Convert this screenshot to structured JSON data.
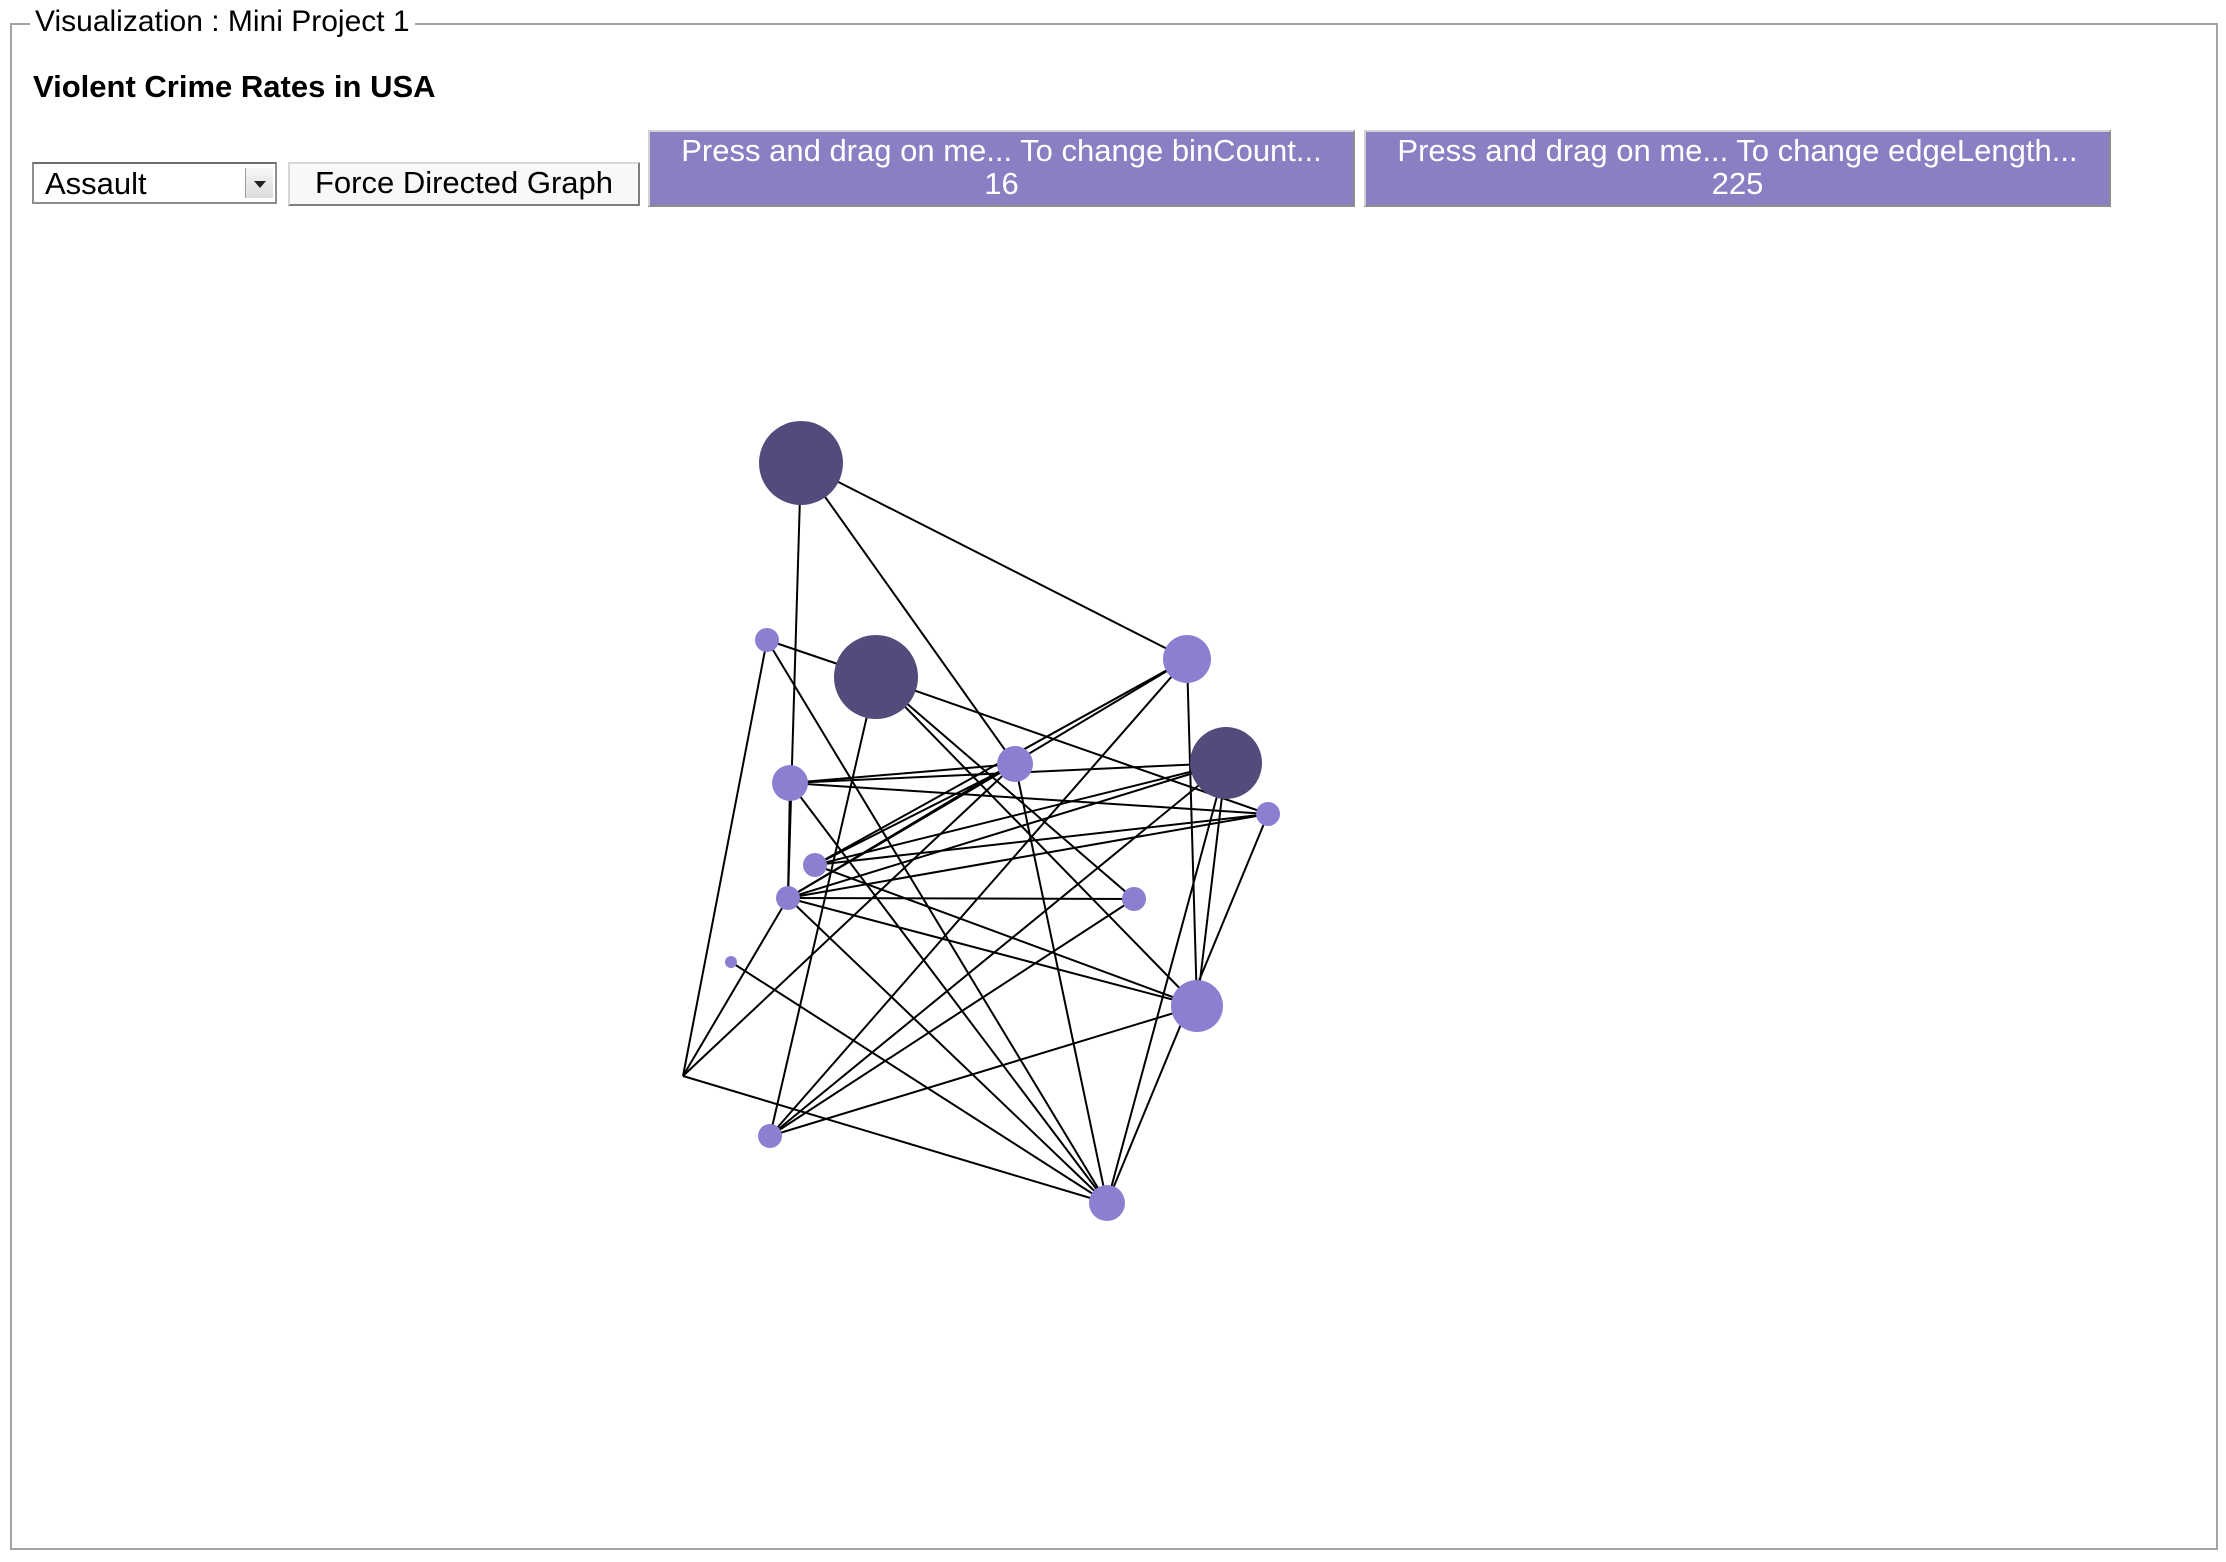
{
  "fieldset": {
    "legend": "Visualization : Mini Project 1"
  },
  "page_title": "Violent Crime Rates in USA",
  "toolbar": {
    "variable_select": {
      "selected": "Assault"
    },
    "graph_button_label": "Force Directed Graph",
    "bin_control": {
      "label": "Press and drag on me... To change binCount...",
      "value": "16"
    },
    "edge_control": {
      "label": "Press and drag on me... To change edgeLength...",
      "value": "225"
    }
  },
  "colors": {
    "control_background": "#8a7fc3",
    "node_light": "#8a7fd1",
    "node_dark": "#544a7c",
    "edge": "#000000"
  }
}
